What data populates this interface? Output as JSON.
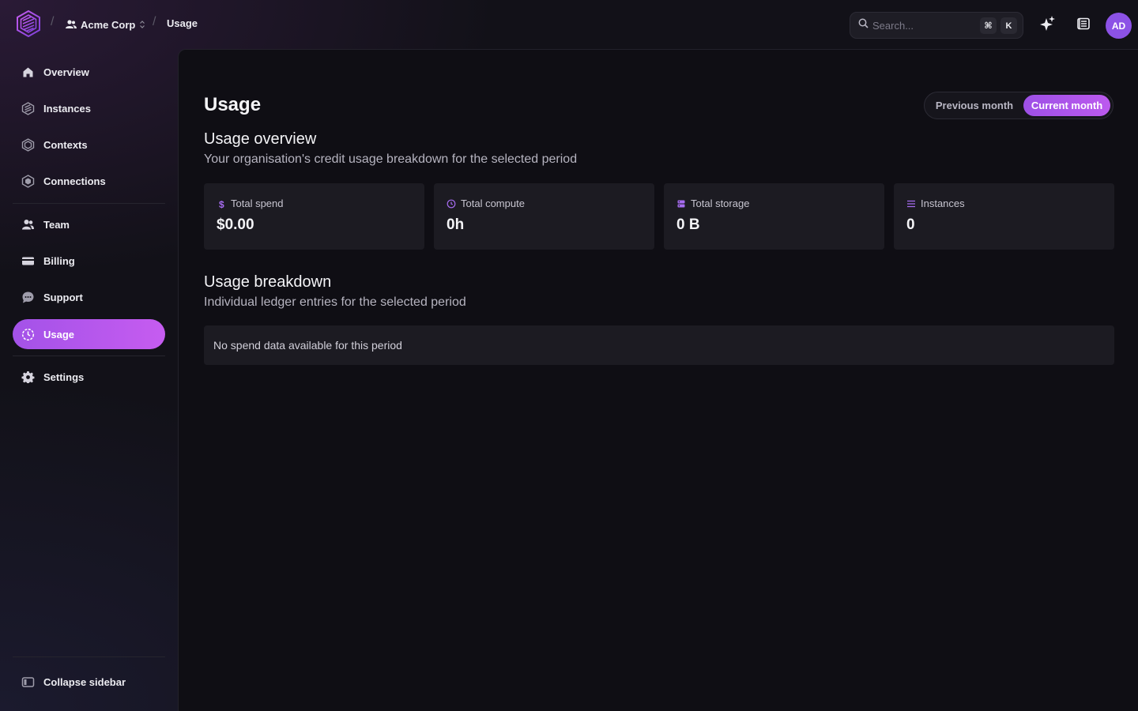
{
  "topbar": {
    "org_name": "Acme Corp",
    "current_page": "Usage",
    "search_placeholder": "Search...",
    "shortcut_modifier": "⌘",
    "shortcut_key": "K",
    "avatar_initials": "AD",
    "separator": "/"
  },
  "sidebar": {
    "items": [
      {
        "label": "Overview",
        "icon": "home-icon"
      },
      {
        "label": "Instances",
        "icon": "instances-icon"
      },
      {
        "label": "Contexts",
        "icon": "contexts-icon"
      },
      {
        "label": "Connections",
        "icon": "connections-icon"
      },
      {
        "label": "Team",
        "icon": "team-icon"
      },
      {
        "label": "Billing",
        "icon": "credit-card-icon"
      },
      {
        "label": "Support",
        "icon": "chat-bubble-icon"
      },
      {
        "label": "Usage",
        "icon": "clock-icon",
        "active": true
      },
      {
        "label": "Settings",
        "icon": "gear-icon"
      }
    ],
    "collapse_label": "Collapse sidebar"
  },
  "main": {
    "title": "Usage",
    "period_toggle": {
      "options": [
        "Previous month",
        "Current month"
      ],
      "selected": "Current month"
    },
    "overview": {
      "title": "Usage overview",
      "subtitle": "Your organisation's credit usage breakdown for the selected period"
    },
    "stats": [
      {
        "label": "Total spend",
        "value": "$0.00",
        "icon": "dollar-icon"
      },
      {
        "label": "Total compute",
        "value": "0h",
        "icon": "clock-icon"
      },
      {
        "label": "Total storage",
        "value": "0 B",
        "icon": "database-icon"
      },
      {
        "label": "Instances",
        "value": "0",
        "icon": "list-icon"
      }
    ],
    "breakdown": {
      "title": "Usage breakdown",
      "subtitle": "Individual ledger entries for the selected period",
      "empty_message": "No spend data available for this period"
    }
  },
  "colors": {
    "accent": "#a352e8",
    "accent_end": "#c65cf0",
    "background": "#121118",
    "card": "#1c1b22"
  }
}
